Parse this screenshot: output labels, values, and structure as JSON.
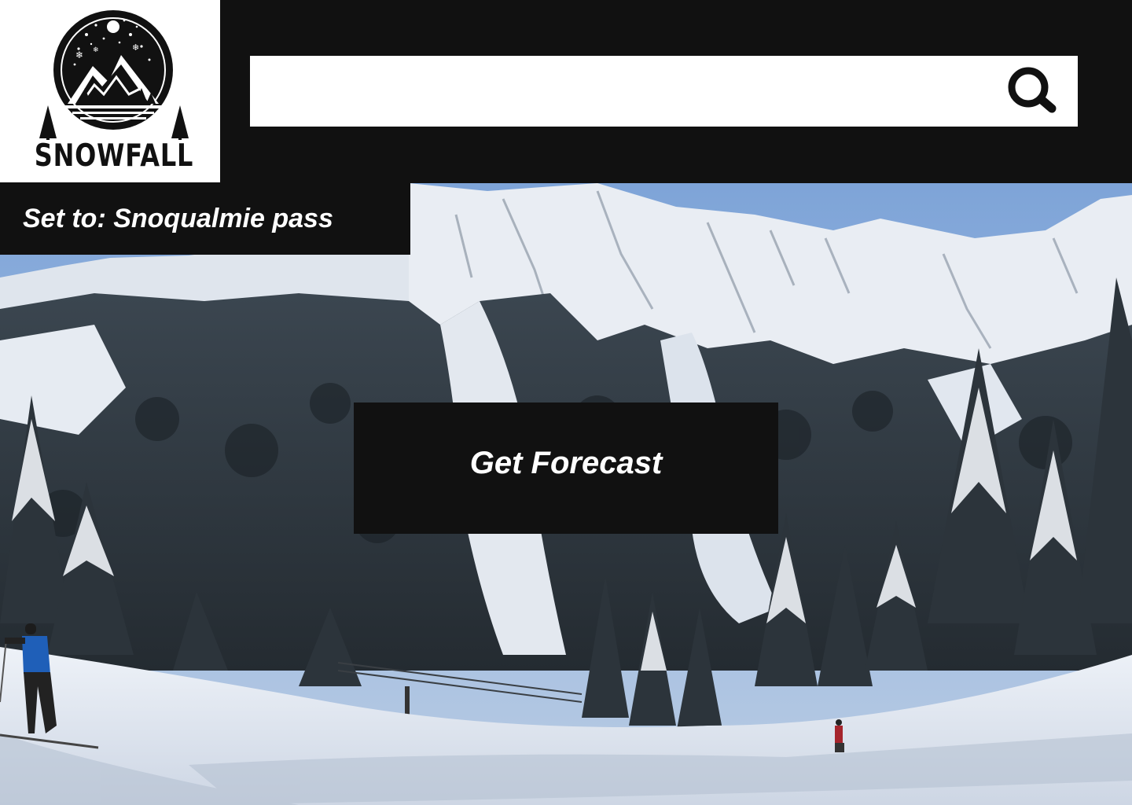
{
  "brand": {
    "name": "SNOWFALL",
    "logo_icon": "mountain-snow-emblem"
  },
  "search": {
    "value": "",
    "icon": "search-icon"
  },
  "location": {
    "label": "Set to: Snoqualmie pass"
  },
  "cta": {
    "label": "Get Forecast"
  },
  "hero_image": {
    "subject": "snowy mountain ski slope"
  },
  "colors": {
    "bar": "#111111",
    "text_on_bar": "#ffffff",
    "search_bg": "#ffffff"
  }
}
